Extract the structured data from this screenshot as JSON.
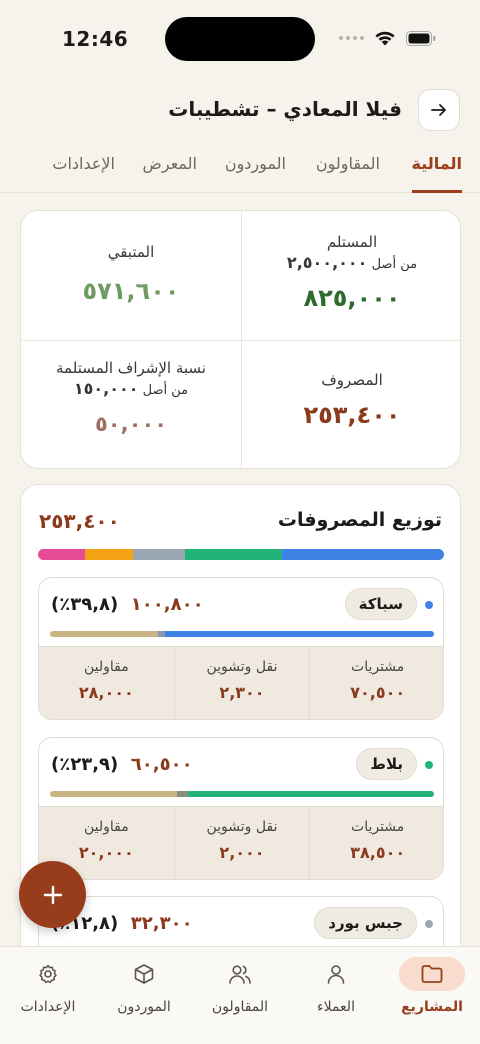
{
  "status": {
    "time": "12:46"
  },
  "header": {
    "title": "فيلا المعادي – تشطيبات"
  },
  "tabs": [
    "المالية",
    "المقاولون",
    "الموردون",
    "المعرض",
    "الإعدادات"
  ],
  "summary": {
    "received": {
      "label": "المستلم",
      "of_prefix": "من أصل",
      "of_value": "٢,٥٠٠,٠٠٠",
      "value": "٨٢٥,٠٠٠",
      "color": "#2e6b2a"
    },
    "remaining": {
      "label": "المتبقي",
      "value": "٥٧١,٦٠٠",
      "color": "#6f9a63"
    },
    "spent": {
      "label": "المصروف",
      "value": "٢٥٣,٤٠٠",
      "color": "#8b3a1c"
    },
    "supervision": {
      "label": "نسبة الإشراف المستلمة",
      "of_prefix": "من أصل",
      "of_value": "١٥٠,٠٠٠",
      "value": "٥٠,٠٠٠",
      "color": "#a07060"
    }
  },
  "distribution": {
    "title": "توزيع المصروفات",
    "total": "٢٥٣,٤٠٠",
    "segments": [
      {
        "color": "#3f82e6",
        "share": 39.8
      },
      {
        "color": "#22b37a",
        "share": 23.9
      },
      {
        "color": "#9aa6b4",
        "share": 12.8
      },
      {
        "color": "#f4a114",
        "share": 12.0
      },
      {
        "color": "#e84b96",
        "share": 11.5
      }
    ],
    "items": [
      {
        "name": "سباكة",
        "dot": "#3f82e6",
        "amount": "١٠٠,٨٠٠",
        "percent": "(٣٩,٨٪)",
        "bar": [
          {
            "color": "#3f82e6",
            "share": 70
          },
          {
            "color": "#8a9bb1",
            "share": 2
          },
          {
            "color": "#c9b483",
            "share": 28
          }
        ],
        "cols": [
          {
            "label": "مشتريات",
            "value": "٧٠,٥٠٠"
          },
          {
            "label": "نقل وتشوين",
            "value": "٢,٣٠٠"
          },
          {
            "label": "مقاولين",
            "value": "٢٨,٠٠٠"
          }
        ]
      },
      {
        "name": "بلاط",
        "dot": "#22b37a",
        "amount": "٦٠,٥٠٠",
        "percent": "(٢٣,٩٪)",
        "bar": [
          {
            "color": "#22b37a",
            "share": 64
          },
          {
            "color": "#8a8e7c",
            "share": 3
          },
          {
            "color": "#c9b483",
            "share": 33
          }
        ],
        "cols": [
          {
            "label": "مشتريات",
            "value": "٣٨,٥٠٠"
          },
          {
            "label": "نقل وتشوين",
            "value": "٢,٠٠٠"
          },
          {
            "label": "مقاولين",
            "value": "٢٠,٠٠٠"
          }
        ]
      },
      {
        "name": "جبس بورد",
        "dot": "#9aa6b4",
        "amount": "٣٢,٣٠٠",
        "percent": "(١٢,٨٪)"
      }
    ]
  },
  "nav": [
    "المشاريع",
    "العملاء",
    "المقاولون",
    "الموردون",
    "الإعدادات"
  ]
}
